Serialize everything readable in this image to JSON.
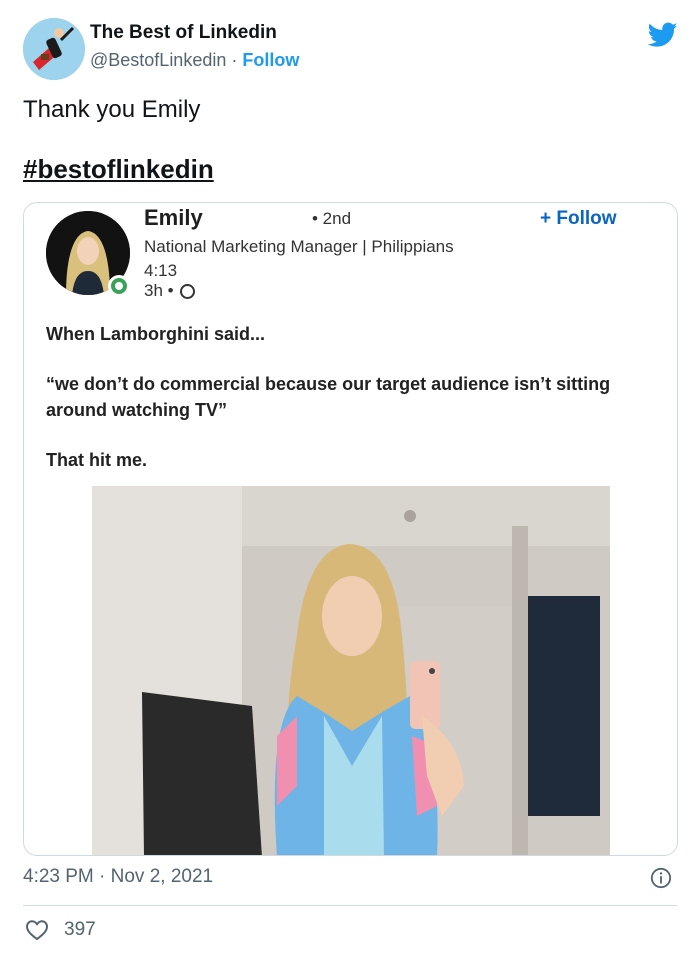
{
  "account": {
    "name": "The Best of Linkedin",
    "handle": "@BestofLinkedin",
    "separator": "·",
    "follow_label": "Follow",
    "avatar_icon": "superhero-avatar-icon"
  },
  "tweet": {
    "text": "Thank you Emily",
    "hashtag": "#bestoflinkedin",
    "timestamp": "4:23 PM · Nov 2, 2021",
    "like_count": "397"
  },
  "linkedin_post": {
    "author": "Emily",
    "degree": "• 2nd",
    "follow_label": "+ Follow",
    "headline": "National Marketing Manager | Philippians 4:13",
    "time": "3h •",
    "paragraphs": [
      "When Lamborghini said...",
      "“we don’t do commercial because our target audience isn’t sitting around watching TV”",
      "That hit me."
    ]
  },
  "colors": {
    "twitter_blue": "#1d9bf0",
    "linkedin_blue": "#0a66c2",
    "secondary_text": "#536471",
    "border": "#cfd9de"
  },
  "icons": [
    "twitter-bird-icon",
    "info-icon",
    "heart-icon",
    "globe-icon",
    "online-status-icon"
  ]
}
